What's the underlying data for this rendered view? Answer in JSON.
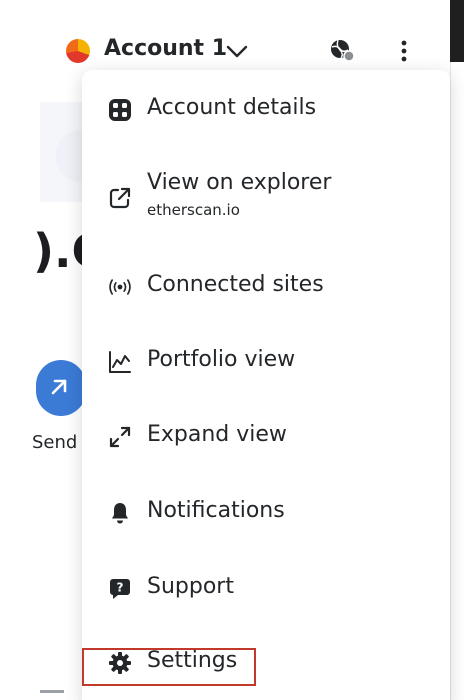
{
  "header": {
    "account_name": "Account 1",
    "icons": {
      "avatar": "account-avatar",
      "chevron": "chevron-down-icon",
      "network": "globe-connection-icon",
      "more": "kebab-menu-icon"
    }
  },
  "background": {
    "balance_fragment": ").C",
    "send_label": "Send"
  },
  "menu": {
    "items": [
      {
        "label": "Account details",
        "icon": "account-details-icon"
      },
      {
        "label": "View on explorer",
        "sublabel": "etherscan.io",
        "icon": "external-link-icon"
      },
      {
        "label": "Connected sites",
        "icon": "connected-sites-icon"
      },
      {
        "label": "Portfolio view",
        "icon": "portfolio-chart-icon"
      },
      {
        "label": "Expand view",
        "icon": "expand-icon"
      },
      {
        "label": "Notifications",
        "icon": "bell-icon"
      },
      {
        "label": "Support",
        "icon": "support-icon"
      },
      {
        "label": "Settings",
        "icon": "gear-icon"
      }
    ]
  },
  "colors": {
    "text": "#24272a",
    "accent": "#3b7bd6",
    "highlight": "#c0392b"
  }
}
